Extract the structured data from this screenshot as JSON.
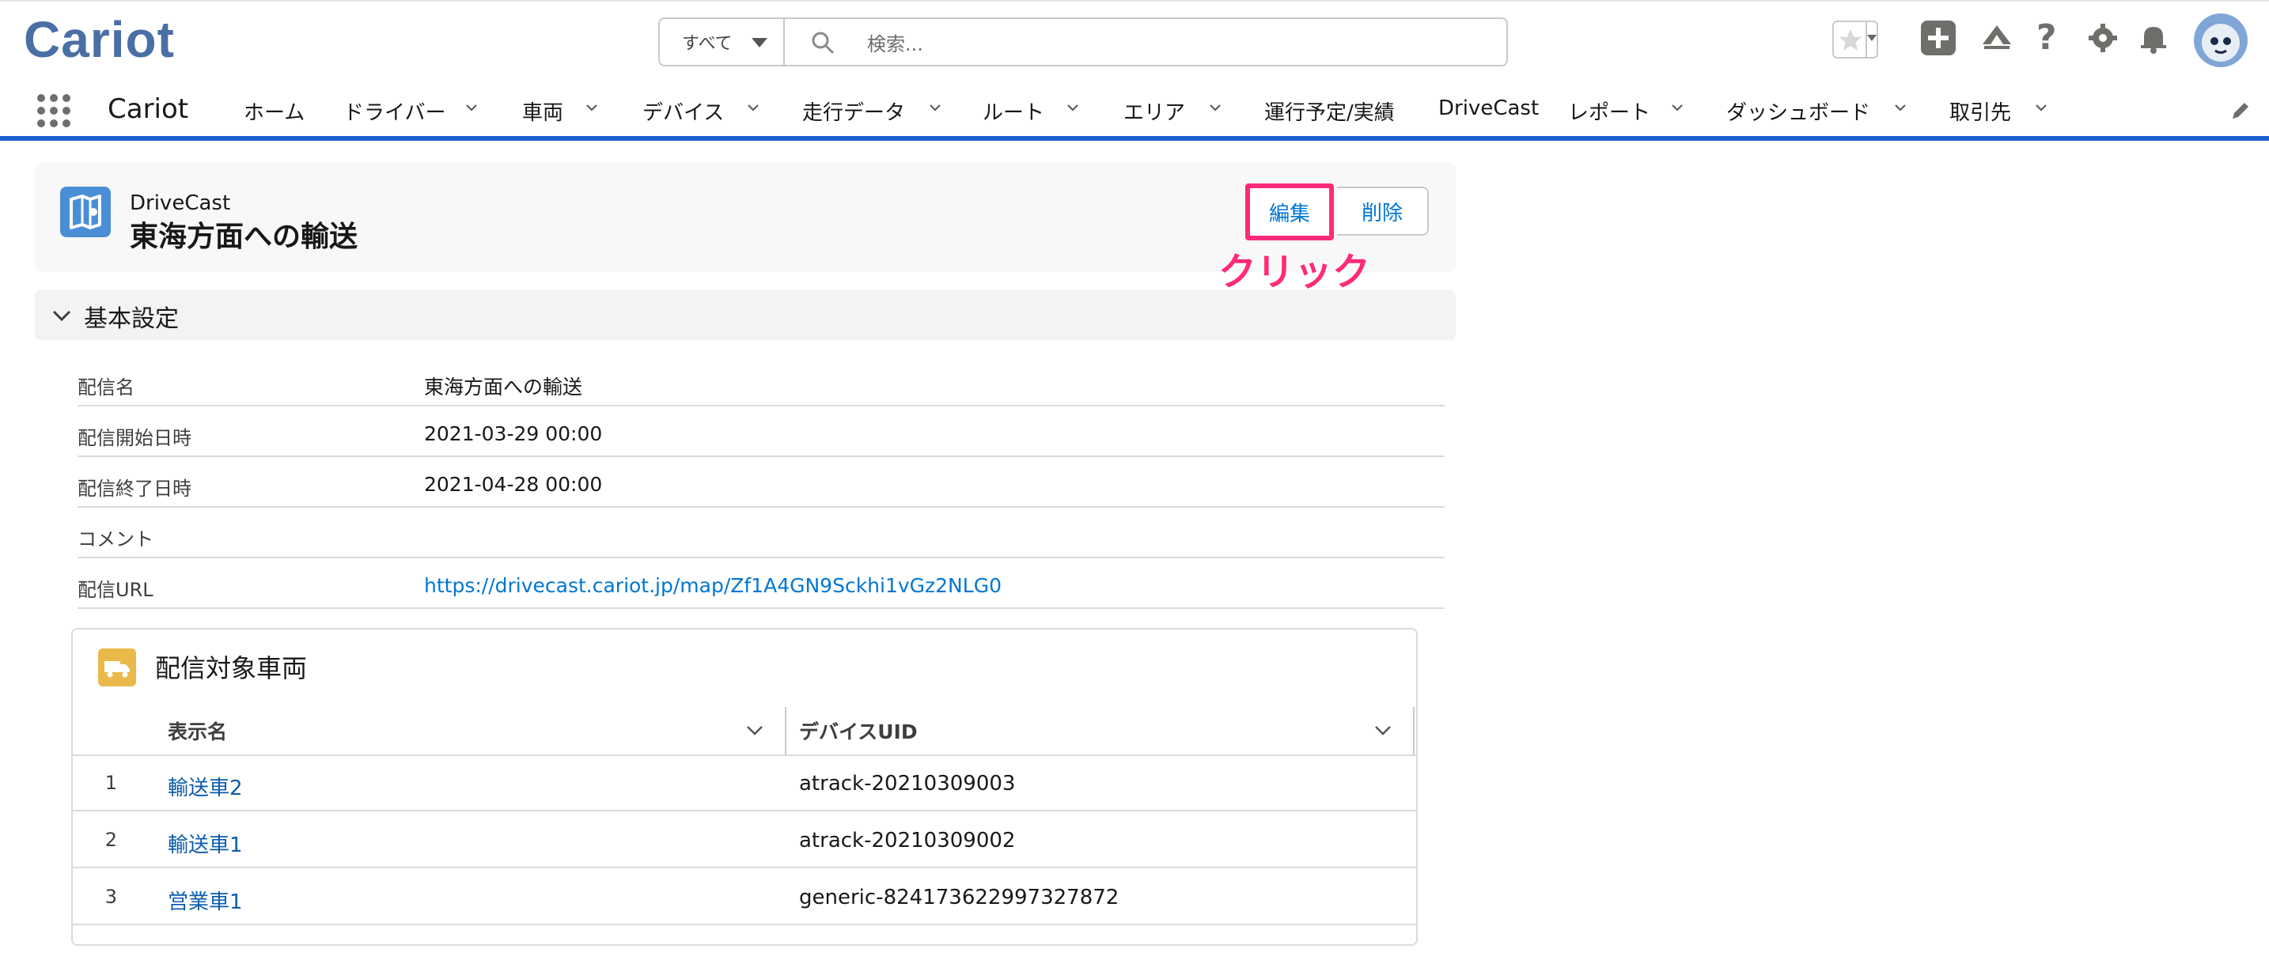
{
  "header": {
    "logo_text": "Cariot",
    "search_scope": "すべて",
    "search_placeholder": "検索..."
  },
  "nav": {
    "app_name": "Cariot",
    "items": [
      {
        "label": "ホーム",
        "has_menu": false
      },
      {
        "label": "ドライバー",
        "has_menu": true
      },
      {
        "label": "車両",
        "has_menu": true
      },
      {
        "label": "デバイス",
        "has_menu": true
      },
      {
        "label": "走行データ",
        "has_menu": true
      },
      {
        "label": "ルート",
        "has_menu": true
      },
      {
        "label": "エリア",
        "has_menu": true
      },
      {
        "label": "運行予定/実績",
        "has_menu": false
      },
      {
        "label": "DriveCast",
        "has_menu": false
      },
      {
        "label": "レポート",
        "has_menu": true
      },
      {
        "label": "ダッシュボード",
        "has_menu": true
      },
      {
        "label": "取引先",
        "has_menu": true
      }
    ]
  },
  "record": {
    "object_name": "DriveCast",
    "record_name": "東海方面への輸送",
    "edit_label": "編集",
    "delete_label": "削除",
    "annotation": "クリック"
  },
  "section": {
    "title": "基本設定",
    "fields": [
      {
        "label": "配信名",
        "value": "東海方面への輸送",
        "link": false
      },
      {
        "label": "配信開始日時",
        "value": "2021-03-29 00:00",
        "link": false
      },
      {
        "label": "配信終了日時",
        "value": "2021-04-28 00:00",
        "link": false
      },
      {
        "label": "コメント",
        "value": "",
        "link": false
      },
      {
        "label": "配信URL",
        "value": "https://drivecast.cariot.jp/map/Zf1A4GN9Sckhi1vGz2NLG0",
        "link": true
      }
    ]
  },
  "related_list": {
    "title": "配信対象車両",
    "columns": [
      "表示名",
      "デバイスUID"
    ],
    "rows": [
      {
        "num": "1",
        "name": "輸送車2",
        "uid": "atrack-20210309003"
      },
      {
        "num": "2",
        "name": "輸送車1",
        "uid": "atrack-20210309002"
      },
      {
        "num": "3",
        "name": "営業車1",
        "uid": "generic-824173622997327872"
      }
    ]
  },
  "colors": {
    "brand_blue": "#1b5fcf",
    "link_blue": "#0176d3",
    "annotation_pink": "#ff2b79"
  }
}
